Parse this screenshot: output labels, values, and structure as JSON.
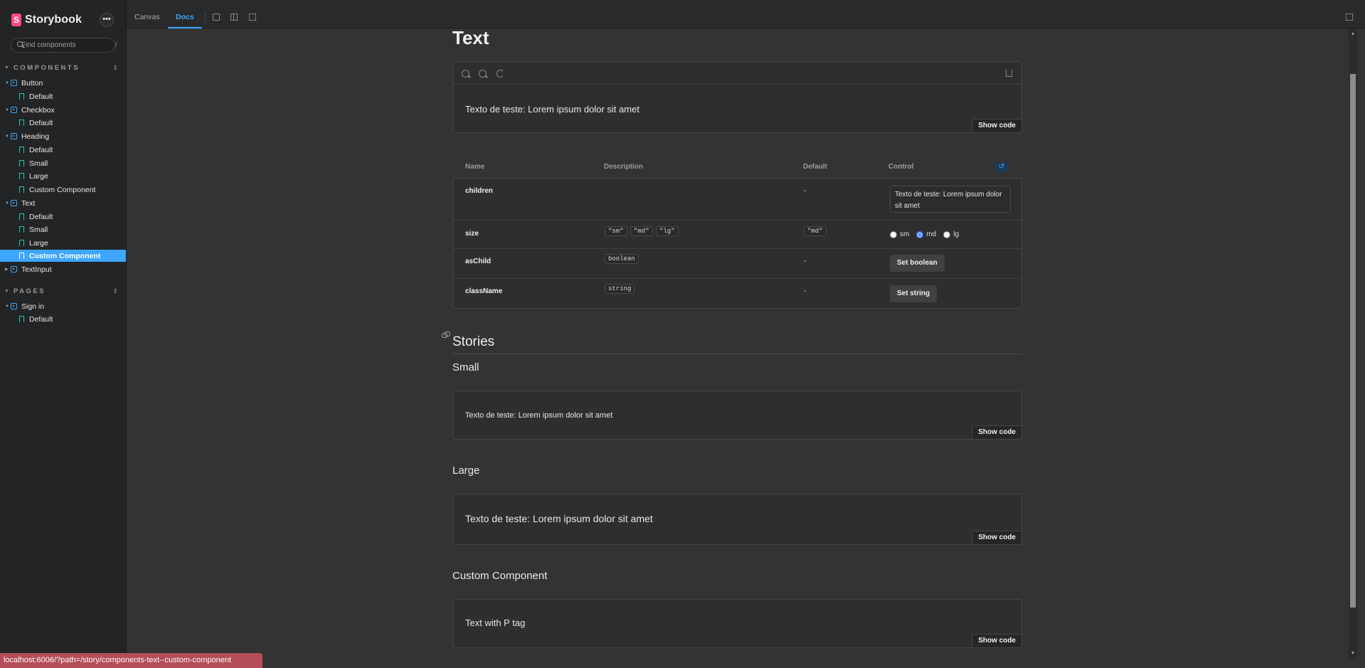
{
  "app": {
    "name": "Storybook",
    "more_label": "•••"
  },
  "search": {
    "placeholder": "Find components",
    "shortcut": "/"
  },
  "sidebar": {
    "components_header": "COMPONENTS",
    "pages_header": "PAGES",
    "items": [
      {
        "label": "Button"
      },
      {
        "label": "Default"
      },
      {
        "label": "Checkbox"
      },
      {
        "label": "Default"
      },
      {
        "label": "Heading"
      },
      {
        "label": "Default"
      },
      {
        "label": "Small"
      },
      {
        "label": "Large"
      },
      {
        "label": "Custom Component"
      },
      {
        "label": "Text"
      },
      {
        "label": "Default"
      },
      {
        "label": "Small"
      },
      {
        "label": "Large"
      },
      {
        "label": "Custom Component"
      },
      {
        "label": "TextInput"
      }
    ],
    "page_items": [
      {
        "label": "Sign in"
      },
      {
        "label": "Default"
      }
    ]
  },
  "toolbar": {
    "tab_canvas": "Canvas",
    "tab_docs": "Docs"
  },
  "doc": {
    "title": "Text",
    "primary_preview_text": "Texto de teste: Lorem ipsum dolor sit amet",
    "show_code": "Show code"
  },
  "args_table": {
    "headers": {
      "name": "Name",
      "description": "Description",
      "default": "Default",
      "control": "Control"
    },
    "rows": [
      {
        "name": "children",
        "default": "-",
        "control_value": "Texto de teste: Lorem ipsum dolor sit amet"
      },
      {
        "name": "size",
        "types": [
          "\"sm\"",
          "\"md\"",
          "\"lg\""
        ],
        "default": "\"md\"",
        "options": [
          "sm",
          "md",
          "lg"
        ],
        "selected": "md"
      },
      {
        "name": "asChild",
        "type": "boolean",
        "default": "-",
        "control_label": "Set boolean"
      },
      {
        "name": "className",
        "type": "string",
        "default": "-",
        "control_label": "Set string"
      }
    ]
  },
  "stories": {
    "heading": "Stories",
    "items": [
      {
        "title": "Small",
        "text": "Texto de teste: Lorem ipsum dolor sit amet"
      },
      {
        "title": "Large",
        "text": "Texto de teste: Lorem ipsum dolor sit amet"
      },
      {
        "title": "Custom Component",
        "text": "Text with P tag"
      }
    ]
  },
  "status_bar": {
    "url": "localhost:6006/?path=/story/components-text--custom-component"
  },
  "colors": {
    "accent": "#3ea6ff",
    "brand": "#ff4785",
    "background": "#333333",
    "sidebar": "#222425",
    "status": "#b34d57"
  }
}
